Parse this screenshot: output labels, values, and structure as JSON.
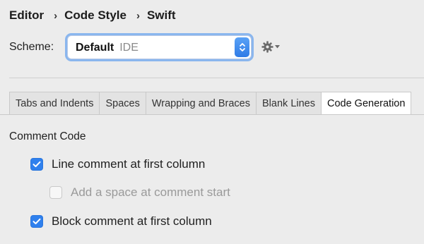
{
  "breadcrumb": {
    "items": [
      "Editor",
      "Code Style",
      "Swift"
    ],
    "separator": "›"
  },
  "scheme": {
    "label": "Scheme:",
    "selected_name": "Default",
    "selected_sub": "IDE"
  },
  "gear": {
    "icon": "gear-icon"
  },
  "tabs": [
    {
      "label": "Tabs and Indents",
      "active": false
    },
    {
      "label": "Spaces",
      "active": false
    },
    {
      "label": "Wrapping and Braces",
      "active": false
    },
    {
      "label": "Blank Lines",
      "active": false
    },
    {
      "label": "Code Generation",
      "active": true
    }
  ],
  "section": {
    "title": "Comment Code"
  },
  "options": [
    {
      "label": "Line comment at first column",
      "checked": true,
      "enabled": true
    },
    {
      "label": "Add a space at comment start",
      "checked": false,
      "enabled": false
    },
    {
      "label": "Block comment at first column",
      "checked": true,
      "enabled": true
    }
  ],
  "colors": {
    "accent": "#2f80ed",
    "focus_ring": "#8ab6ee",
    "background": "#ececec"
  }
}
